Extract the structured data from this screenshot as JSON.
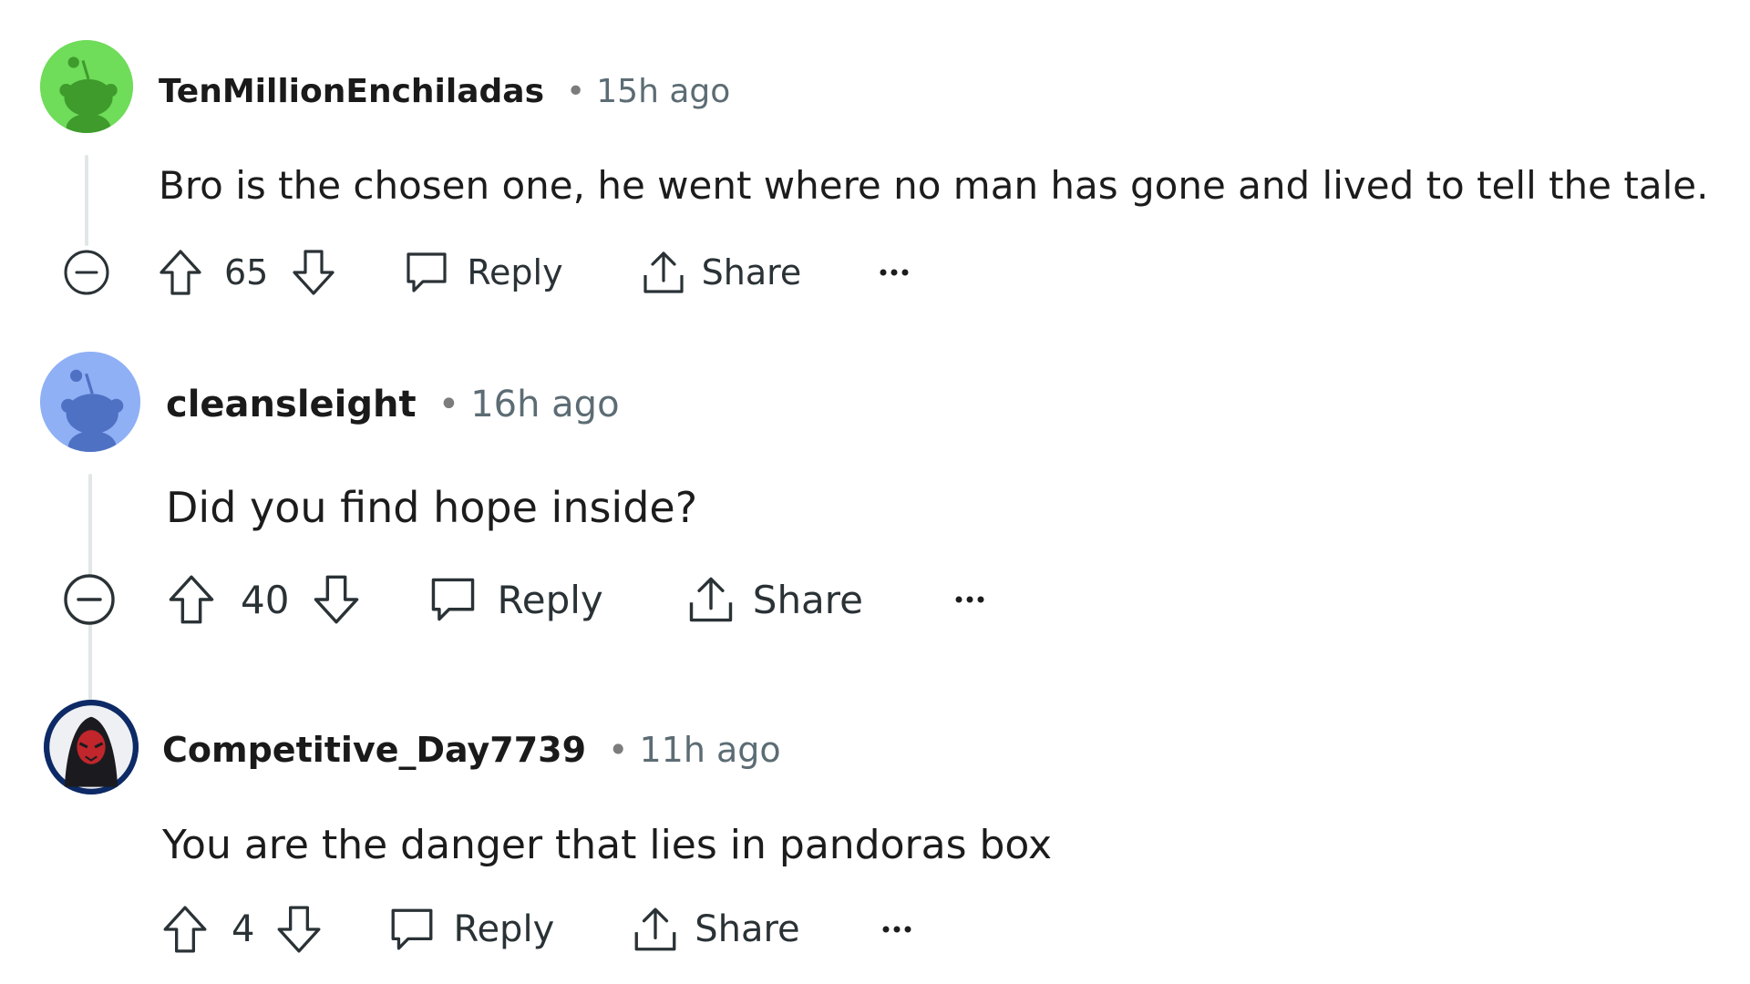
{
  "comments": [
    {
      "username": "TenMillionEnchiladas",
      "separator": "•",
      "time": "15h ago",
      "body": "Bro is the chosen one, he went where no man has gone and lived to tell the tale.",
      "score": "65",
      "reply_label": "Reply",
      "share_label": "Share",
      "avatar_color": "#6fdc5a",
      "avatar_figure_color": "#3f9b2c",
      "avatar_type": "snoo-icon"
    },
    {
      "username": "cleansleight",
      "separator": "•",
      "time": "16h ago",
      "body": "Did you find hope inside?",
      "score": "40",
      "reply_label": "Reply",
      "share_label": "Share",
      "avatar_color": "#8fb0f5",
      "avatar_figure_color": "#4f71c4",
      "avatar_type": "snoo-icon"
    },
    {
      "username": "Competitive_Day7739",
      "separator": "•",
      "time": "11h ago",
      "body": "You are the danger that lies in pandoras box",
      "score": "4",
      "reply_label": "Reply",
      "share_label": "Share",
      "avatar_color": "#0d2a66",
      "avatar_figure_color": "#c0262b",
      "avatar_type": "hooded-figure-icon"
    }
  ],
  "colors": {
    "text": "#1c1c1c",
    "meta": "#5c6c74",
    "thread_line": "#e2e6e8",
    "icon": "#2a3236"
  }
}
